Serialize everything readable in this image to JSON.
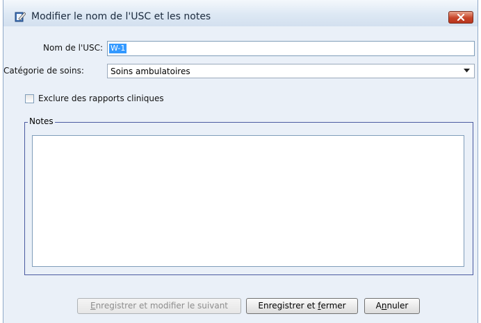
{
  "window": {
    "title": "Modifier le nom de l'USC et les notes",
    "icon": "edit-document-icon",
    "close_icon": "close-icon"
  },
  "form": {
    "name_label": "Nom de l'USC:",
    "name_value": "W-1",
    "category_label": "Catégorie de soins:",
    "category_value": "Soins ambulatoires",
    "exclude_label": "Exclure des rapports cliniques",
    "exclude_checked": false,
    "notes_label": "Notes",
    "notes_value": ""
  },
  "buttons": {
    "save_next_pre": "E",
    "save_next_rest": "nregistrer et modifier le suivant",
    "save_close_pre": "Enregistrer et ",
    "save_close_acc": "f",
    "save_close_post": "ermer",
    "cancel_pre": "A",
    "cancel_acc": "n",
    "cancel_post": "nuler"
  },
  "colors": {
    "dialog_bg": "#eaf0f8",
    "selection": "#3399ff",
    "close_button": "#c7452a",
    "group_border": "#4a5aa0"
  }
}
